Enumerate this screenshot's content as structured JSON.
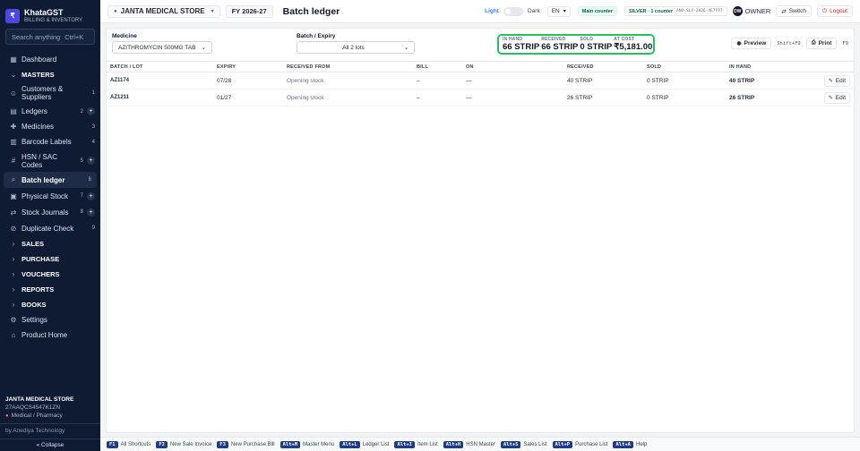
{
  "brand": {
    "logo": "₹",
    "name": "KhataGST",
    "subtitle": "BILLING & INVENTORY"
  },
  "search": {
    "placeholder": "Search anything",
    "shortcut": "Ctrl+K"
  },
  "sidebar": {
    "items": [
      {
        "icon": "▦",
        "label": "Dashboard",
        "count": "",
        "plus": false
      },
      {
        "icon": "⌄",
        "label": "MASTERS",
        "count": "",
        "plus": false,
        "section": true
      },
      {
        "icon": "☺",
        "label": "Customers & Suppliers",
        "count": "1",
        "plus": false
      },
      {
        "icon": "▤",
        "label": "Ledgers",
        "count": "2",
        "plus": true
      },
      {
        "icon": "✚",
        "label": "Medicines",
        "count": "3",
        "plus": false
      },
      {
        "icon": "▥",
        "label": "Barcode Labels",
        "count": "4",
        "plus": false
      },
      {
        "icon": "#",
        "label": "HSN / SAC Codes",
        "count": "5",
        "plus": true
      },
      {
        "icon": "⌕",
        "label": "Batch ledger",
        "count": "6",
        "plus": false,
        "active": true
      },
      {
        "icon": "▣",
        "label": "Physical Stock",
        "count": "7",
        "plus": true
      },
      {
        "icon": "⇄",
        "label": "Stock Journals",
        "count": "8",
        "plus": true
      },
      {
        "icon": "⊘",
        "label": "Duplicate Check",
        "count": "9",
        "plus": false
      },
      {
        "icon": "›",
        "label": "SALES",
        "count": "",
        "plus": false,
        "section": true
      },
      {
        "icon": "›",
        "label": "PURCHASE",
        "count": "",
        "plus": false,
        "section": true
      },
      {
        "icon": "›",
        "label": "VOUCHERS",
        "count": "",
        "plus": false,
        "section": true
      },
      {
        "icon": "›",
        "label": "REPORTS",
        "count": "",
        "plus": false,
        "section": true
      },
      {
        "icon": "›",
        "label": "BOOKS",
        "count": "",
        "plus": false,
        "section": true
      },
      {
        "icon": "⚙",
        "label": "Settings",
        "count": "",
        "plus": false
      },
      {
        "icon": "⌂",
        "label": "Product Home",
        "count": "",
        "plus": false
      }
    ],
    "store_name": "JANTA MEDICAL STORE",
    "store_gstin": "27AAQCS4547K1ZN",
    "store_type": "Medical / Pharmacy",
    "by": "by Anediya Technology",
    "collapse": "« Collapse"
  },
  "topbar": {
    "store": "JANTA MEDICAL STORE",
    "fy": "FY 2026-27",
    "title": "Batch ledger",
    "theme_light": "Light",
    "theme_dark": "Dark",
    "lang": "EN",
    "counter": "Main counter",
    "plan": "SILVER · 1 counter",
    "plan_code": "ANO-SLV-2026-4E7F97",
    "avatar": "OW",
    "user": "OWNER",
    "switch": "Switch",
    "logout": "Logout"
  },
  "filters": {
    "medicine_label": "Medicine",
    "medicine_value": "AZITHROMYCIN 500MG TAB",
    "batch_label": "Batch / Expiry",
    "batch_value": "All 2 lots"
  },
  "summary": [
    {
      "label": "IN HAND",
      "value": "66 STRIP"
    },
    {
      "label": "RECEIVED",
      "value": "66 STRIP"
    },
    {
      "label": "SOLD",
      "value": "0 STRIP"
    },
    {
      "label": "AT COST",
      "value": "₹5,181.00"
    }
  ],
  "actions": {
    "preview": "Preview",
    "preview_kbd": "Shift+F9",
    "print": "Print",
    "print_kbd": "F9"
  },
  "table": {
    "headers": [
      "BATCH / LOT",
      "EXPIRY",
      "RECEIVED FROM",
      "BILL",
      "ON",
      "RECEIVED",
      "SOLD",
      "IN HAND"
    ],
    "rows": [
      {
        "batch": "AZ1174",
        "expiry": "07/28",
        "from": "Opening stock",
        "bill": "–",
        "on": "—",
        "received": "40 STRIP",
        "sold": "0 STRIP",
        "in_hand": "40 STRIP",
        "action": "Edit"
      },
      {
        "batch": "AZ1211",
        "expiry": "01/27",
        "from": "Opening stock",
        "bill": "–",
        "on": "—",
        "received": "26 STRIP",
        "sold": "0 STRIP",
        "in_hand": "26 STRIP",
        "action": "Edit"
      }
    ]
  },
  "shortcuts": [
    {
      "key": "F1",
      "label": "All Shortcuts"
    },
    {
      "key": "F2",
      "label": "New Sale Invoice"
    },
    {
      "key": "F3",
      "label": "New Purchase Bill"
    },
    {
      "key": "Alt+M",
      "label": "Master Menu"
    },
    {
      "key": "Alt+L",
      "label": "Ledger List"
    },
    {
      "key": "Alt+I",
      "label": "Item List"
    },
    {
      "key": "Alt+H",
      "label": "HSN Master"
    },
    {
      "key": "Alt+S",
      "label": "Sales List"
    },
    {
      "key": "Alt+P",
      "label": "Purchase List"
    },
    {
      "key": "Alt+A",
      "label": "Help"
    }
  ]
}
